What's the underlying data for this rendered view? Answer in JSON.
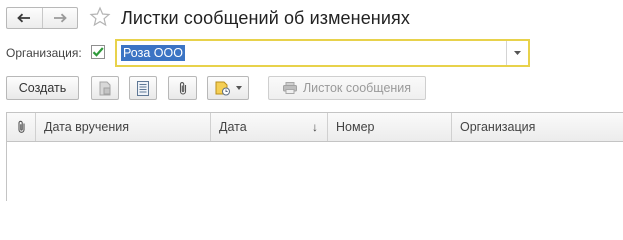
{
  "window": {
    "title": "Листки сообщений об изменениях",
    "back_icon": "arrow-left-icon",
    "forward_icon": "arrow-right-icon",
    "favorite_icon": "star-outline-icon"
  },
  "filter": {
    "label": "Организация:",
    "checkbox_checked": true,
    "value": "Роза ООО",
    "value_selected": true,
    "field_border_color": "#e8d24b",
    "selection_color": "#3b74c4"
  },
  "toolbar": {
    "create_label": "Создать",
    "icon_buttons": [
      "document-icon",
      "list-icon",
      "paperclip-icon",
      "print-settings-icon"
    ],
    "message_label": "Листок сообщения",
    "message_enabled": false
  },
  "table": {
    "columns": [
      "Дата вручения",
      "Дата",
      "Номер",
      "Организация"
    ],
    "sort_column": "Дата",
    "sort_direction": "descending",
    "sort_indicator": "↓",
    "rows": []
  }
}
